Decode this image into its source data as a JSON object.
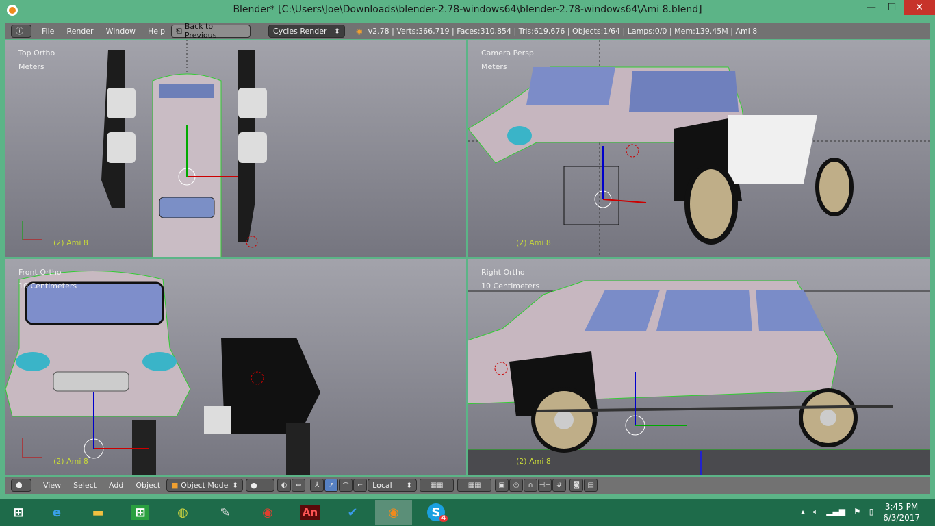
{
  "window": {
    "title": "Blender* [C:\\Users\\Joe\\Downloads\\blender-2.78-windows64\\blender-2.78-windows64\\Ami 8.blend]",
    "minimize": "—",
    "maximize": "☐",
    "close": "✕"
  },
  "header": {
    "menus": [
      "File",
      "Render",
      "Window",
      "Help"
    ],
    "back_button": "Back to Previous",
    "render_engine": "Cycles Render",
    "stats": "v2.78 | Verts:366,719 | Faces:310,854 | Tris:619,676 | Objects:1/64 | Lamps:0/0 | Mem:139.45M | Ami 8"
  },
  "viewports": [
    {
      "view": "Top Ortho",
      "units": "Meters",
      "object": "(2) Ami 8"
    },
    {
      "view": "Camera Persp",
      "units": "Meters",
      "object": "(2) Ami 8"
    },
    {
      "view": "Front Ortho",
      "units": "10 Centimeters",
      "object": "(2) Ami 8"
    },
    {
      "view": "Right Ortho",
      "units": "10 Centimeters",
      "object": "(2) Ami 8"
    }
  ],
  "footer": {
    "menus": [
      "View",
      "Select",
      "Add",
      "Object"
    ],
    "mode": "Object Mode",
    "orientation": "Local"
  },
  "taskbar": {
    "time": "3:45 PM",
    "date": "6/3/2017",
    "apps": [
      "start",
      "internet-explorer",
      "file-explorer",
      "store",
      "app",
      "paint",
      "chrome",
      "animate",
      "todo",
      "blender",
      "skype"
    ],
    "skype_badge": "4",
    "animate_label": "An"
  }
}
